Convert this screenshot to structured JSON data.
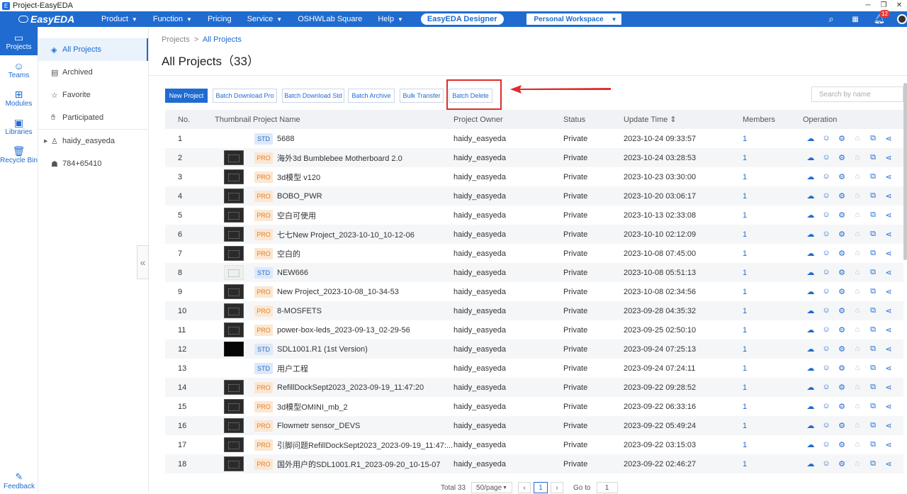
{
  "window": {
    "title": "Project-EasyEDA"
  },
  "navbar": {
    "logo": "EasyEDA",
    "items": [
      {
        "label": "Product",
        "dropdown": true
      },
      {
        "label": "Function",
        "dropdown": true
      },
      {
        "label": "Pricing",
        "dropdown": false
      },
      {
        "label": "Service",
        "dropdown": true
      },
      {
        "label": "OSHWLab Square",
        "dropdown": false
      },
      {
        "label": "Help",
        "dropdown": true
      }
    ],
    "designer_button": "EasyEDA Designer",
    "workspace": "Personal Workspace",
    "notification_count": "12",
    "accent": "#1f6bd0"
  },
  "rail": {
    "items": [
      "Projects",
      "Teams",
      "Modules",
      "Libraries",
      "Recycle Bin"
    ],
    "feedback": "Feedback"
  },
  "sidebar": {
    "items": [
      "All Projects",
      "Archived",
      "Favorite",
      "Participated"
    ],
    "user": "haidy_easyeda",
    "team": "784+65410"
  },
  "main": {
    "breadcrumb": {
      "root": "Projects",
      "sep": ">",
      "current": "All Projects"
    },
    "title": "All Projects（33）",
    "buttons": [
      "New Project",
      "Batch Download Pro",
      "Batch Download Std",
      "Batch Archive",
      "Bulk Transfer",
      "Batch Delete"
    ],
    "search_placeholder": "Search by name",
    "columns": [
      "No.",
      "Thumbnail",
      "Project Name",
      "Project Owner",
      "Status",
      "Update Time ⇕",
      "Members",
      "Operation"
    ],
    "rows": [
      {
        "no": "1",
        "thumb": "blank",
        "tag": "STD",
        "name": "5688",
        "owner": "haidy_easyeda",
        "status": "Private",
        "time": "2023-10-24 09:33:57",
        "members": "1"
      },
      {
        "no": "2",
        "thumb": "board",
        "tag": "PRO",
        "name": "海外3d Bumblebee Motherboard 2.0",
        "owner": "haidy_easyeda",
        "status": "Private",
        "time": "2023-10-24 03:28:53",
        "members": "1"
      },
      {
        "no": "3",
        "thumb": "board",
        "tag": "PRO",
        "name": "3d模型 v120",
        "owner": "haidy_easyeda",
        "status": "Private",
        "time": "2023-10-23 03:30:00",
        "members": "1"
      },
      {
        "no": "4",
        "thumb": "board",
        "tag": "PRO",
        "name": "BOBO_PWR",
        "owner": "haidy_easyeda",
        "status": "Private",
        "time": "2023-10-20 03:06:17",
        "members": "1"
      },
      {
        "no": "5",
        "thumb": "board",
        "tag": "PRO",
        "name": "空白可使用",
        "owner": "haidy_easyeda",
        "status": "Private",
        "time": "2023-10-13 02:33:08",
        "members": "1"
      },
      {
        "no": "6",
        "thumb": "board",
        "tag": "PRO",
        "name": "七七New Project_2023-10-10_10-12-06",
        "owner": "haidy_easyeda",
        "status": "Private",
        "time": "2023-10-10 02:12:09",
        "members": "1"
      },
      {
        "no": "7",
        "thumb": "board",
        "tag": "PRO",
        "name": "空白的",
        "owner": "haidy_easyeda",
        "status": "Private",
        "time": "2023-10-08 07:45:00",
        "members": "1"
      },
      {
        "no": "8",
        "thumb": "light",
        "tag": "STD",
        "name": "NEW666",
        "owner": "haidy_easyeda",
        "status": "Private",
        "time": "2023-10-08 05:51:13",
        "members": "1"
      },
      {
        "no": "9",
        "thumb": "board",
        "tag": "PRO",
        "name": "New Project_2023-10-08_10-34-53",
        "owner": "haidy_easyeda",
        "status": "Private",
        "time": "2023-10-08 02:34:56",
        "members": "1"
      },
      {
        "no": "10",
        "thumb": "board",
        "tag": "PRO",
        "name": "8-MOSFETS",
        "owner": "haidy_easyeda",
        "status": "Private",
        "time": "2023-09-28 04:35:32",
        "members": "1"
      },
      {
        "no": "11",
        "thumb": "board",
        "tag": "PRO",
        "name": "power-box-leds_2023-09-13_02-29-56",
        "owner": "haidy_easyeda",
        "status": "Private",
        "time": "2023-09-25 02:50:10",
        "members": "1"
      },
      {
        "no": "12",
        "thumb": "dark",
        "tag": "STD",
        "name": "SDL1001.R1 (1st Version)",
        "owner": "haidy_easyeda",
        "status": "Private",
        "time": "2023-09-24 07:25:13",
        "members": "1"
      },
      {
        "no": "13",
        "thumb": "blank",
        "tag": "STD",
        "name": "用户工程",
        "owner": "haidy_easyeda",
        "status": "Private",
        "time": "2023-09-24 07:24:11",
        "members": "1"
      },
      {
        "no": "14",
        "thumb": "board",
        "tag": "PRO",
        "name": "RefillDockSept2023_2023-09-19_11:47:20",
        "owner": "haidy_easyeda",
        "status": "Private",
        "time": "2023-09-22 09:28:52",
        "members": "1"
      },
      {
        "no": "15",
        "thumb": "board",
        "tag": "PRO",
        "name": "3d模型OMINI_mb_2",
        "owner": "haidy_easyeda",
        "status": "Private",
        "time": "2023-09-22 06:33:16",
        "members": "1"
      },
      {
        "no": "16",
        "thumb": "board",
        "tag": "PRO",
        "name": "Flowmetr sensor_DEVS",
        "owner": "haidy_easyeda",
        "status": "Private",
        "time": "2023-09-22 05:49:24",
        "members": "1"
      },
      {
        "no": "17",
        "thumb": "board",
        "tag": "PRO",
        "name": "引脚问题RefillDockSept2023_2023-09-19_11:47:...",
        "owner": "haidy_easyeda",
        "status": "Private",
        "time": "2023-09-22 03:15:03",
        "members": "1"
      },
      {
        "no": "18",
        "thumb": "board",
        "tag": "PRO",
        "name": "国外用户的SDL1001.R1_2023-09-20_10-15-07",
        "owner": "haidy_easyeda",
        "status": "Private",
        "time": "2023-09-22 02:46:27",
        "members": "1"
      }
    ],
    "pager": {
      "total": "Total 33",
      "page_size": "50/page",
      "current": "1",
      "goto_label": "Go to",
      "goto_value": "1"
    }
  }
}
